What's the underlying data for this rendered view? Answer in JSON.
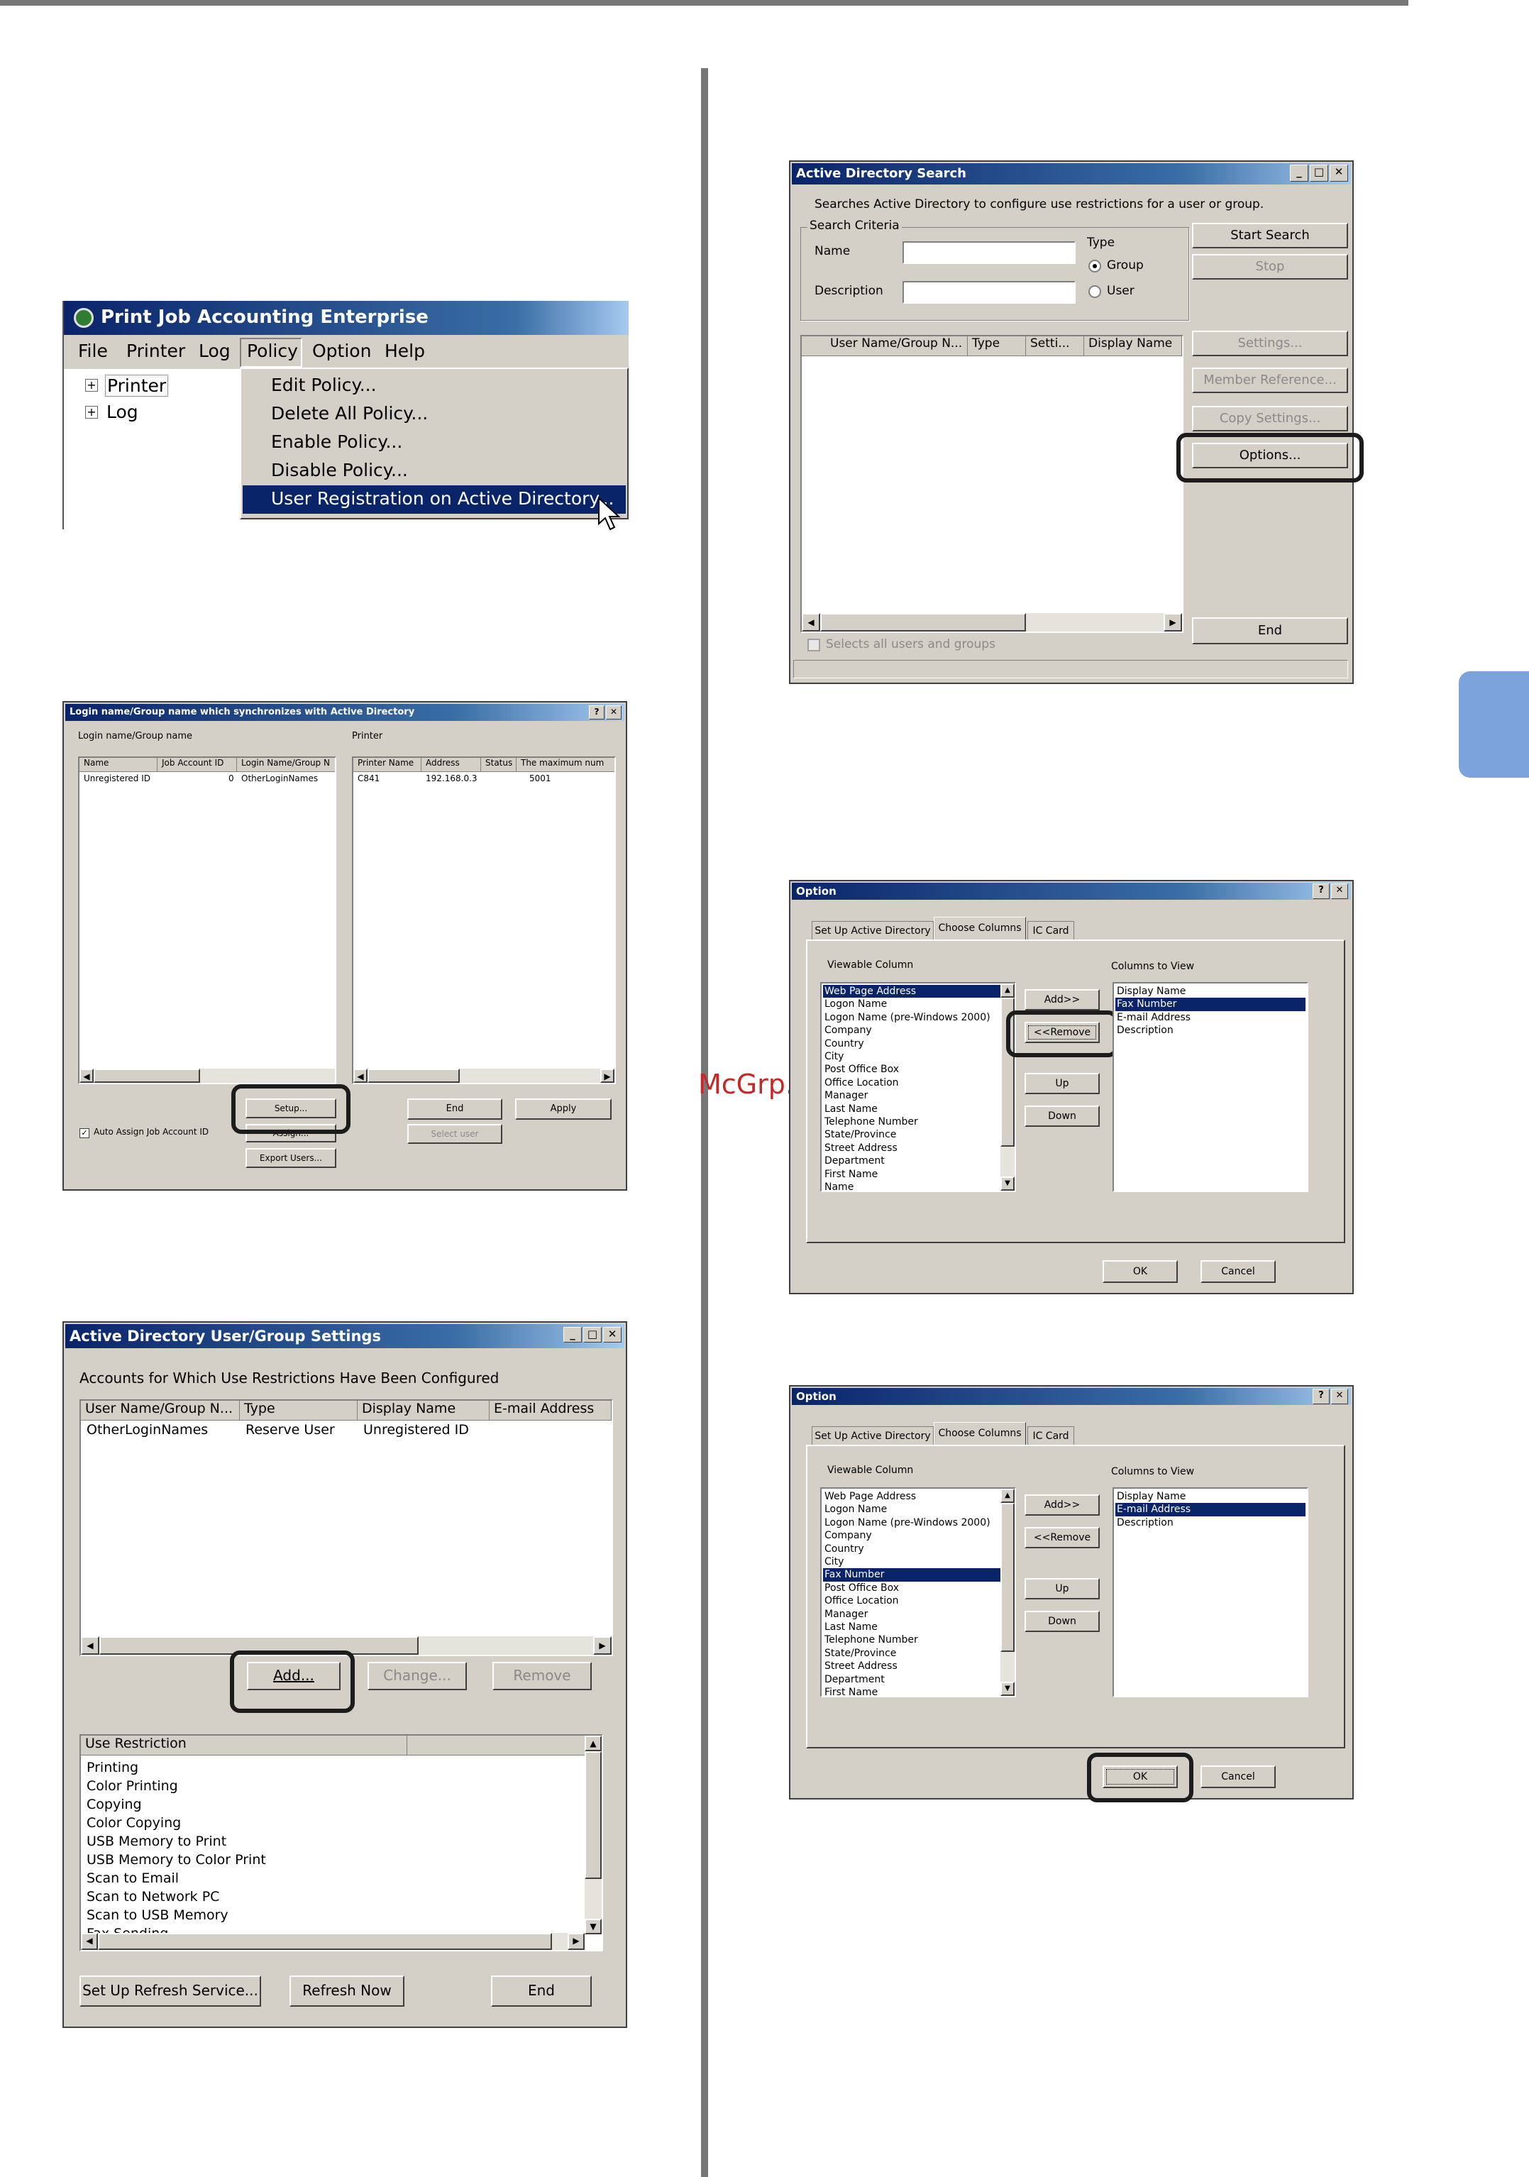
{
  "watermark": "McGrp.Ru",
  "colors": {
    "accent_tab": "#7da3dc",
    "title_bar": "#0a246a",
    "selection": "#0a246a"
  },
  "fig1": {
    "title": "Print Job Accounting Enterprise",
    "menu": [
      "File",
      "Printer",
      "Log",
      "Policy",
      "Option",
      "Help"
    ],
    "tree": [
      "Printer",
      "Log"
    ],
    "policy_menu": [
      "Edit Policy...",
      "Delete All Policy...",
      "Enable Policy...",
      "Disable Policy...",
      "User Registration on Active Directory..."
    ]
  },
  "fig2": {
    "title": "Login name/Group name which synchronizes with Active Directory",
    "left_label": "Login name/Group name",
    "right_label": "Printer",
    "left_cols": [
      "Name",
      "Job Account ID",
      "Login Name/Group N"
    ],
    "left_row": [
      "Unregistered ID",
      "0",
      "OtherLoginNames"
    ],
    "right_cols": [
      "Printer Name",
      "Address",
      "Status",
      "The maximum num"
    ],
    "right_row": [
      "C841",
      "192.168.0.3",
      "",
      "5001"
    ],
    "setup": "Setup...",
    "assign": "Assign...",
    "export": "Export Users...",
    "end": "End",
    "apply": "Apply",
    "select_user": "Select user",
    "auto_assign": "Auto Assign Job Account ID"
  },
  "fig3": {
    "title": "Active Directory User/Group Settings",
    "caption": "Accounts for Which Use Restrictions Have Been Configured",
    "cols": [
      "User Name/Group N...",
      "Type",
      "Display Name",
      "E-mail Address"
    ],
    "row": [
      "OtherLoginNames",
      "Reserve User",
      "Unregistered ID",
      ""
    ],
    "add": "Add...",
    "change": "Change...",
    "remove": "Remove",
    "restriction_header": "Use Restriction",
    "restrictions": [
      "Printing",
      "Color Printing",
      "Copying",
      "Color Copying",
      "USB Memory to Print",
      "USB Memory to Color Print",
      "Scan to Email",
      "Scan to Network PC",
      "Scan to USB Memory",
      "Fax Sending"
    ],
    "refresh_service": "Set Up Refresh Service...",
    "refresh_now": "Refresh Now",
    "end": "End"
  },
  "fig4": {
    "title": "Active Directory Search",
    "desc": "Searches Active Directory to configure use restrictions for a user or group.",
    "criteria": "Search Criteria",
    "name_label": "Name",
    "description_label": "Description",
    "type_label": "Type",
    "group": "Group",
    "user": "User",
    "start": "Start Search",
    "stop": "Stop",
    "cols": [
      "User Name/Group N...",
      "Type",
      "Setti...",
      "Display Name"
    ],
    "settings": "Settings...",
    "member_ref": "Member Reference...",
    "copy_settings": "Copy Settings...",
    "options": "Options...",
    "end": "End",
    "select_all": "Selects all users and groups"
  },
  "fig5": {
    "title": "Option",
    "tabs": [
      "Set Up Active Directory",
      "Choose Columns",
      "IC Card"
    ],
    "viewable": "Viewable Column",
    "to_view": "Columns to View",
    "list": [
      "Web Page Address",
      "Logon Name",
      "Logon Name (pre-Windows 2000)",
      "Company",
      "Country",
      "City",
      "Post Office Box",
      "Office Location",
      "Manager",
      "Last Name",
      "Telephone Number",
      "State/Province",
      "Street Address",
      "Department",
      "First Name",
      "Name"
    ],
    "view_list": [
      "Display Name",
      "Fax Number",
      "E-mail Address",
      "Description"
    ],
    "add": "Add>>",
    "remove": "<<Remove",
    "up": "Up",
    "down": "Down",
    "ok": "OK",
    "cancel": "Cancel"
  },
  "fig6": {
    "title": "Option",
    "tabs": [
      "Set Up Active Directory",
      "Choose Columns",
      "IC Card"
    ],
    "viewable": "Viewable Column",
    "to_view": "Columns to View",
    "list": [
      "Web Page Address",
      "Logon Name",
      "Logon Name (pre-Windows 2000)",
      "Company",
      "Country",
      "City",
      "Fax Number",
      "Post Office Box",
      "Office Location",
      "Manager",
      "Last Name",
      "Telephone Number",
      "State/Province",
      "Street Address",
      "Department",
      "First Name"
    ],
    "view_list": [
      "Display Name",
      "E-mail Address",
      "Description"
    ],
    "add": "Add>>",
    "remove": "<<Remove",
    "up": "Up",
    "down": "Down",
    "ok": "OK",
    "cancel": "Cancel"
  }
}
